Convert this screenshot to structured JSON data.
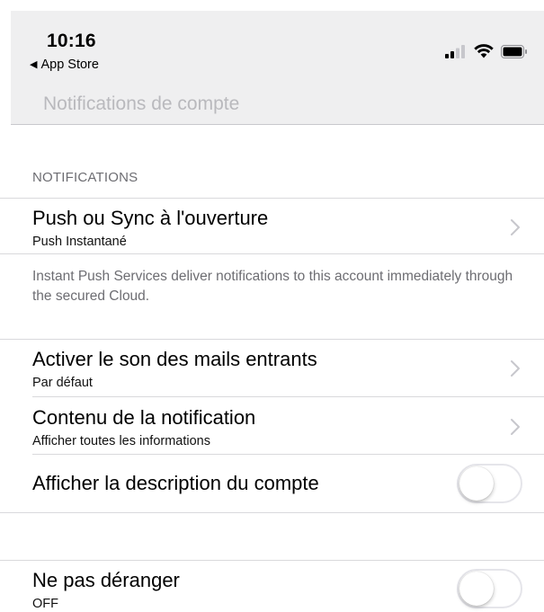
{
  "status_bar": {
    "time": "10:16",
    "back_label": "App Store"
  },
  "nav": {
    "title": "Notifications de compte"
  },
  "section": {
    "header": "NOTIFICATIONS"
  },
  "rows": {
    "push": {
      "title": "Push ou Sync à l'ouverture",
      "subtitle": "Push Instantané"
    },
    "push_note": "Instant Push Services deliver notifications to this account immediately through the secured Cloud.",
    "sound": {
      "title": "Activer le son des mails entrants",
      "subtitle": "Par défaut"
    },
    "content": {
      "title": "Contenu de la notification",
      "subtitle": "Afficher toutes les informations"
    },
    "description": {
      "title": "Afficher la description du compte",
      "toggle_on": false
    },
    "dnd": {
      "title": "Ne pas déranger",
      "subtitle": "OFF",
      "toggle_on": false
    }
  },
  "colors": {
    "header_bg": "#efeff0",
    "secondary_text": "#6d6d72",
    "separator": "#d9d9dc",
    "chevron": "#c7c7cc"
  }
}
